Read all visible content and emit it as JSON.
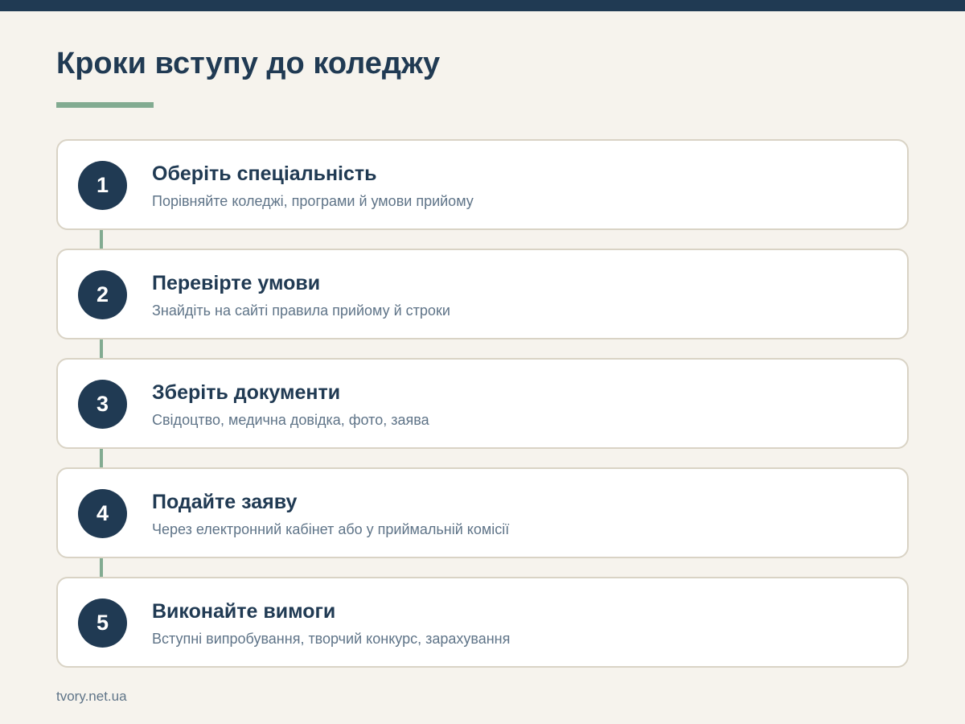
{
  "title": "Кроки вступу до коледжу",
  "colors": {
    "navy": "#203a53",
    "accent_green": "#82ab91",
    "background": "#f6f3ed",
    "card_border": "#d9d3c5",
    "muted_text": "#5f7488"
  },
  "steps": [
    {
      "number": "1",
      "title": "Оберіть спеціальність",
      "description": "Порівняйте коледжі, програми й умови прийому"
    },
    {
      "number": "2",
      "title": "Перевірте умови",
      "description": "Знайдіть на сайті правила прийому й строки"
    },
    {
      "number": "3",
      "title": "Зберіть документи",
      "description": "Свідоцтво, медична довідка, фото, заява"
    },
    {
      "number": "4",
      "title": "Подайте заяву",
      "description": "Через електронний кабінет або у приймальній комісії"
    },
    {
      "number": "5",
      "title": "Виконайте вимоги",
      "description": "Вступні випробування, творчий конкурс, зарахування"
    }
  ],
  "footer": "tvory.net.ua"
}
